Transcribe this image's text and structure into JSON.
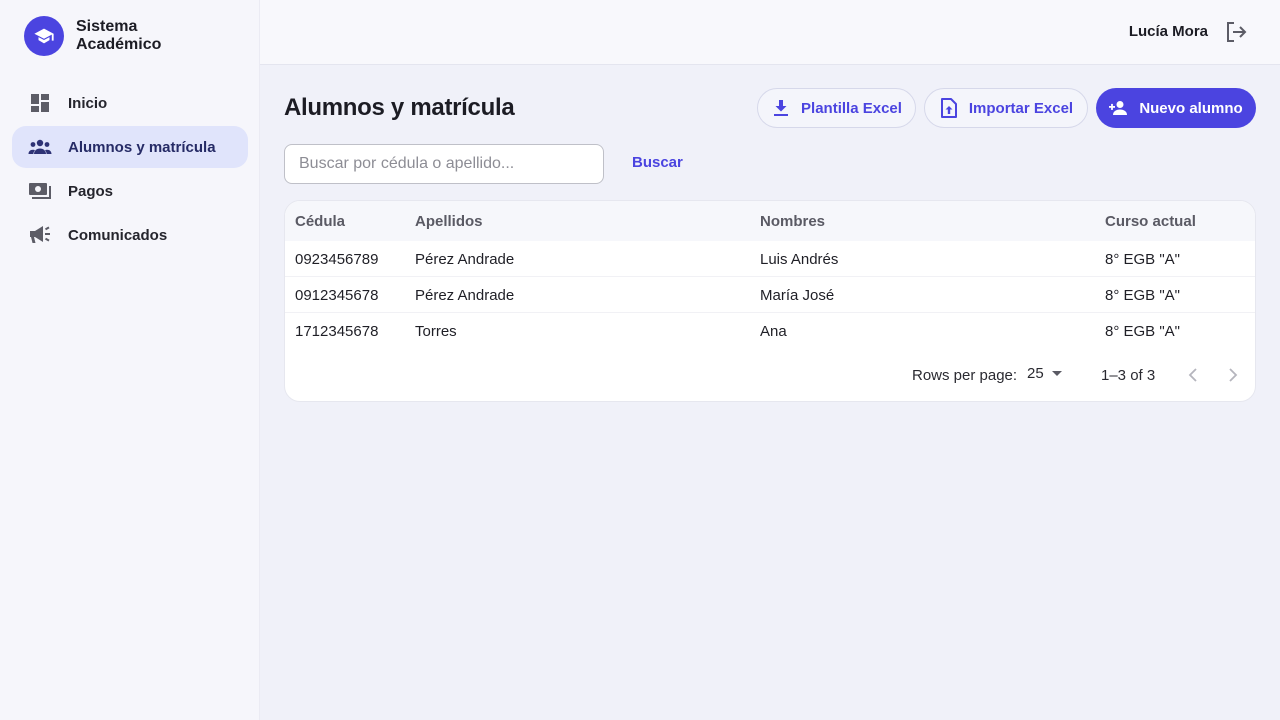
{
  "brand": {
    "title": "Sistema Académico",
    "accent": "#4b44e0"
  },
  "sidebar": {
    "items": [
      {
        "label": "Inicio",
        "icon": "dashboard-icon",
        "active": false
      },
      {
        "label": "Alumnos y matrícula",
        "icon": "people-icon",
        "active": true
      },
      {
        "label": "Pagos",
        "icon": "payments-icon",
        "active": false
      },
      {
        "label": "Comunicados",
        "icon": "megaphone-icon",
        "active": false
      }
    ]
  },
  "header": {
    "user_name": "Lucía Mora",
    "logout_icon": "logout-icon"
  },
  "main": {
    "title": "Alumnos y matrícula",
    "actions": {
      "template_label": "Plantilla Excel",
      "import_label": "Importar Excel",
      "new_label": "Nuevo alumno"
    },
    "search": {
      "placeholder": "Buscar por cédula o apellido...",
      "value": "",
      "button_label": "Buscar"
    },
    "table": {
      "columns": [
        "Cédula",
        "Apellidos",
        "Nombres",
        "Curso actual"
      ],
      "rows": [
        [
          "0923456789",
          "Pérez Andrade",
          "Luis Andrés",
          "8° EGB \"A\""
        ],
        [
          "0912345678",
          "Pérez Andrade",
          "María José",
          "8° EGB \"A\""
        ],
        [
          "1712345678",
          "Torres",
          "Ana",
          "8° EGB \"A\""
        ]
      ],
      "pagination": {
        "rows_per_page_label": "Rows per page:",
        "rows_per_page": "25",
        "range": "1–3 of 3"
      }
    }
  }
}
